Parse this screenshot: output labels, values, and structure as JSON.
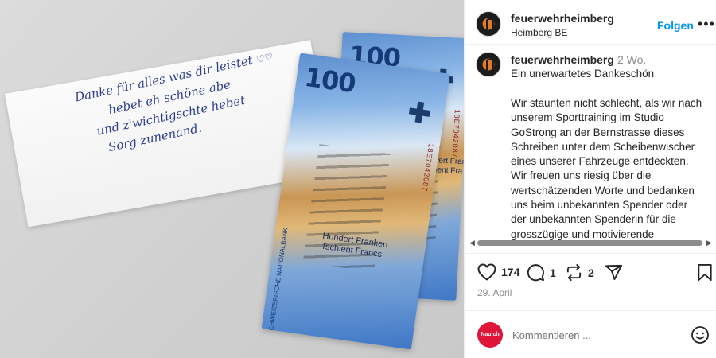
{
  "photo": {
    "note_lines": [
      "Danke für alles was dir leistet",
      "hebet eh schöne abe",
      "und z'wichtigschte hebet",
      "Sorg zunenand."
    ],
    "note_hearts": "♡♡",
    "banknote": {
      "denomination": "100",
      "name_de": "Hundert Franken",
      "name_rm": "Tschient Francs",
      "serial": "18E7042087",
      "bank_text": "SCHWEIZERISCHE NATIONALBANK"
    }
  },
  "post": {
    "header": {
      "username": "feuerwehrheimberg",
      "location": "Heimberg BE",
      "follow_label": "Folgen",
      "more_label": "•••"
    },
    "caption": {
      "username": "feuerwehrheimberg",
      "time": "2 Wo.",
      "title": "Ein unerwartetes Dankeschön",
      "body_lines": [
        "Wir staunten nicht schlecht, als wir nach",
        "unserem Sporttraining im Studio",
        "GoStrong an der Bernstrasse dieses",
        "Schreiben unter dem Scheibenwischer",
        "eines unserer Fahrzeuge entdeckten.",
        "Wir freuen uns riesig über die",
        "wertschätzenden Worte und bedanken",
        "uns beim unbekannten Spender oder",
        "der unbekannten Spenderin für die",
        "grosszügige und motivierende"
      ]
    },
    "actions": {
      "likes": "174",
      "comments": "1",
      "reposts": "2"
    },
    "date": "29. April",
    "comment_box": {
      "avatar_label": "Nau.ch",
      "placeholder": "Kommentieren ..."
    }
  },
  "icons": {
    "like": "heart-icon",
    "comment": "comment-bubble-icon",
    "repost": "repost-icon",
    "share": "paper-plane-icon",
    "save": "bookmark-icon",
    "emoji": "emoji-icon"
  },
  "colors": {
    "link_blue": "#0095f6",
    "text": "#262626",
    "muted": "#8e8e8e",
    "commenter_avatar": "#e0153a"
  }
}
